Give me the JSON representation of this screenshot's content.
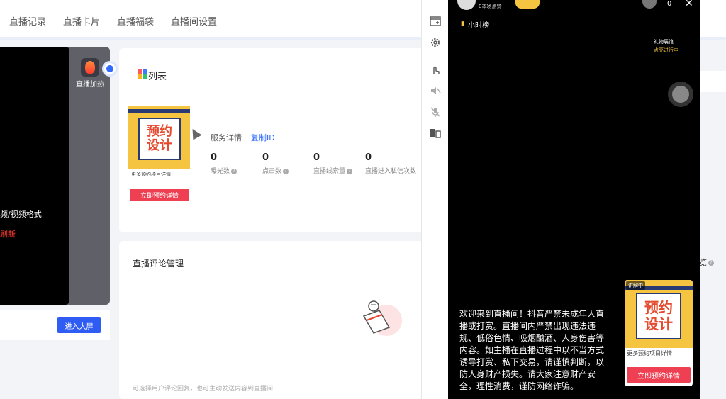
{
  "nav": {
    "tabs": [
      "直播记录",
      "直播卡片",
      "直播福袋",
      "直播间设置"
    ]
  },
  "preview": {
    "format_text": "频/视频格式",
    "refresh_text": "刷新",
    "boost_label": "直播加热",
    "big_screen_button": "进入大屏"
  },
  "product": {
    "list_title": "列表",
    "promo_line1": "预约",
    "promo_line2": "设计",
    "promo_caption": "更多预约项目详情",
    "promo_button": "立即预约详情",
    "service_detail": "服务详情",
    "copy_id": "复制ID",
    "stats": [
      {
        "value": "0",
        "label": "曝光数"
      },
      {
        "value": "0",
        "label": "点击数"
      },
      {
        "value": "0",
        "label": "直播线索量"
      },
      {
        "value": "0",
        "label": "直播进入私信次数"
      }
    ]
  },
  "comments": {
    "title": "直播评论管理",
    "hint": "可选择用户评论回复，也可主动发送内容到直播间"
  },
  "right_fragment": "览",
  "phone": {
    "likes": "0本场点赞",
    "viewer_count": "0",
    "close": "✕",
    "rank_label": "小时榜",
    "gift_title": "礼物展馆",
    "gift_status": "点亮进行中",
    "notice": "欢迎来到直播间！抖音严禁未成年人直播或打赏。直播间内严禁出现违法违规、低俗色情、吸烟酗酒、人身伤害等内容。如主播在直播过程中以不当方式诱导打赏、私下交易，请谨慎判断，以防人身财产损失。请大家注意财产安全，理性消费，谨防网络诈骗。",
    "card": {
      "badge": "讲解中",
      "line1": "预约",
      "line2": "设计",
      "caption": "更多预约项目详情",
      "button": "立即预约详情"
    }
  }
}
